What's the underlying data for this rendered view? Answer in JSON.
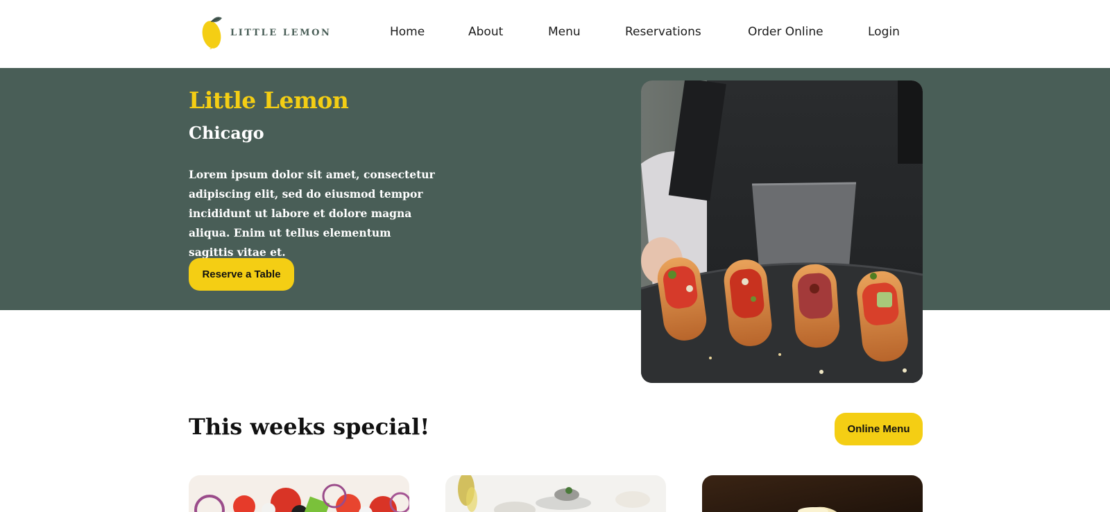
{
  "header": {
    "logo_text": "LITTLE LEMON",
    "nav": [
      "Home",
      "About",
      "Menu",
      "Reservations",
      "Order Online",
      "Login"
    ]
  },
  "hero": {
    "title": "Little Lemon",
    "city": "Chicago",
    "description": "Lorem ipsum dolor sit amet, consectetur adipiscing elit, sed do eiusmod tempor incididunt ut labore et dolore magna aliqua. Enim ut tellus elementum sagittis vitae et.",
    "button": "Reserve a Table",
    "image": "waiter-holding-bruschetta-tray"
  },
  "specials": {
    "title": "This weeks special!",
    "button": "Online Menu",
    "cards": [
      {
        "image": "greek-salad-photo"
      },
      {
        "image": "bruschetta-photo"
      },
      {
        "image": "lemon-dessert-photo"
      }
    ]
  },
  "colors": {
    "primary_green": "#495e57",
    "primary_yellow": "#f4ce14",
    "text_dark": "#111111"
  }
}
